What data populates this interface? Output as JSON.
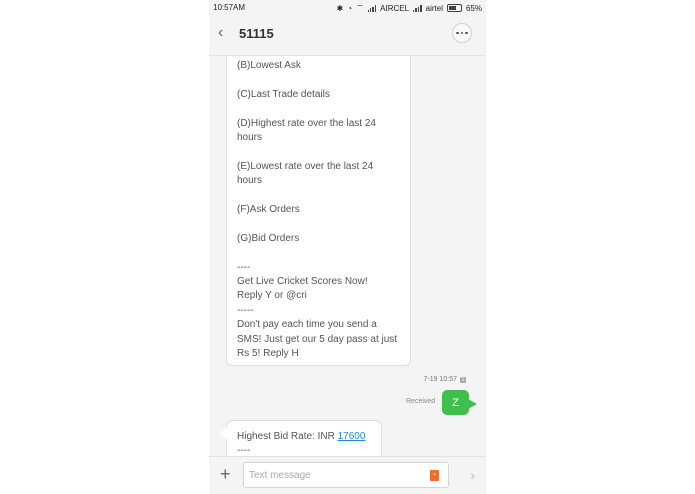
{
  "status_bar": {
    "time": "10:57AM",
    "carrier1": "AIRCEL",
    "carrier2": "airtel",
    "battery": "65%",
    "battery_level": 0.65
  },
  "header": {
    "back_icon": "chevron-left-icon",
    "title": "51115",
    "more_icon": "more-dots-icon"
  },
  "messages": {
    "incoming_1_lines": [
      "(B)Lowest Ask",
      "",
      "(C)Last Trade details",
      "",
      "(D)Highest rate over the last 24",
      "hours",
      "",
      "(E)Lowest rate over the last 24",
      "hours",
      "",
      "(F)Ask Orders",
      "",
      "(G)Bid Orders",
      "",
      "----",
      "Get Live Cricket Scores Now!",
      "Reply Y or @cri",
      "-----",
      "Don't pay each time you send a",
      "SMS! Just get our 5 day pass at just",
      "Rs 5! Reply H"
    ],
    "timestamp": "7-19 10:57",
    "received_label": "Received",
    "outgoing_text": "Z",
    "incoming_2_prefix": "Highest Bid Rate: INR ",
    "incoming_2_link": "17600",
    "incoming_2_after": "----"
  },
  "composer": {
    "add_icon": "plus-icon",
    "placeholder": "Text message",
    "attach_icon": "sim-attach-icon",
    "send_icon": "send-arrow-icon"
  },
  "colors": {
    "outgoing_bubble": "#3fbf4b",
    "link": "#1e88e5",
    "attach": "#ef6c2b"
  }
}
